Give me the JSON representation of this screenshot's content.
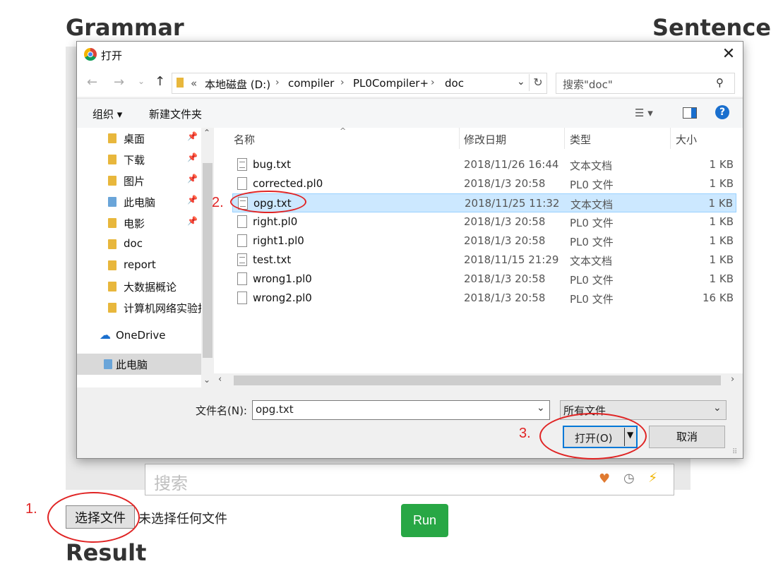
{
  "page": {
    "grammar_heading": "Grammar",
    "sentence_heading": "Sentence",
    "result_heading": "Result",
    "search_placeholder": "搜索",
    "choose_file_button": "选择文件",
    "no_file_text": "未选择任何文件",
    "run_button": "Run",
    "run_color": "#28a745"
  },
  "annotations": {
    "step1": "1.",
    "step2": "2.",
    "step3": "3.",
    "color": "#e02424"
  },
  "dialog": {
    "title": "打开",
    "close_icon": "close-icon",
    "breadcrumb": [
      "«",
      "本地磁盘 (D:)",
      "compiler",
      "PL0Compiler+",
      "doc"
    ],
    "search_placeholder": "搜索\"doc\"",
    "toolbar": {
      "organize": "组织 ▾",
      "new_folder": "新建文件夹",
      "help": "?"
    },
    "nav_items": [
      {
        "label": "桌面",
        "pinned": true
      },
      {
        "label": "下载",
        "pinned": true
      },
      {
        "label": "图片",
        "pinned": true
      },
      {
        "label": "此电脑",
        "pinned": true
      },
      {
        "label": "电影",
        "pinned": true
      },
      {
        "label": "doc",
        "pinned": false
      },
      {
        "label": "report",
        "pinned": false
      },
      {
        "label": "大数据概论",
        "pinned": false
      },
      {
        "label": "计算机网络实验报",
        "pinned": false
      },
      {
        "label": "OneDrive",
        "pinned": false
      },
      {
        "label": "此电脑",
        "pinned": false,
        "selected": true
      }
    ],
    "columns": {
      "name": "名称",
      "date": "修改日期",
      "type": "类型",
      "size": "大小"
    },
    "files": [
      {
        "name": "bug.txt",
        "date": "2018/11/26 16:44",
        "type": "文本文档",
        "size": "1 KB",
        "kind": "txt"
      },
      {
        "name": "corrected.pl0",
        "date": "2018/1/3 20:58",
        "type": "PL0 文件",
        "size": "1 KB",
        "kind": "pl0"
      },
      {
        "name": "opg.txt",
        "date": "2018/11/25 11:32",
        "type": "文本文档",
        "size": "1 KB",
        "kind": "txt",
        "selected": true
      },
      {
        "name": "right.pl0",
        "date": "2018/1/3 20:58",
        "type": "PL0 文件",
        "size": "1 KB",
        "kind": "pl0"
      },
      {
        "name": "right1.pl0",
        "date": "2018/1/3 20:58",
        "type": "PL0 文件",
        "size": "1 KB",
        "kind": "pl0"
      },
      {
        "name": "test.txt",
        "date": "2018/11/15 21:29",
        "type": "文本文档",
        "size": "1 KB",
        "kind": "txt"
      },
      {
        "name": "wrong1.pl0",
        "date": "2018/1/3 20:58",
        "type": "PL0 文件",
        "size": "1 KB",
        "kind": "pl0"
      },
      {
        "name": "wrong2.pl0",
        "date": "2018/1/3 20:58",
        "type": "PL0 文件",
        "size": "16 KB",
        "kind": "pl0"
      }
    ],
    "filename_label": "文件名(N):",
    "filename_value": "opg.txt",
    "filter_value": "所有文件",
    "open_button": "打开(O)",
    "cancel_button": "取消"
  }
}
